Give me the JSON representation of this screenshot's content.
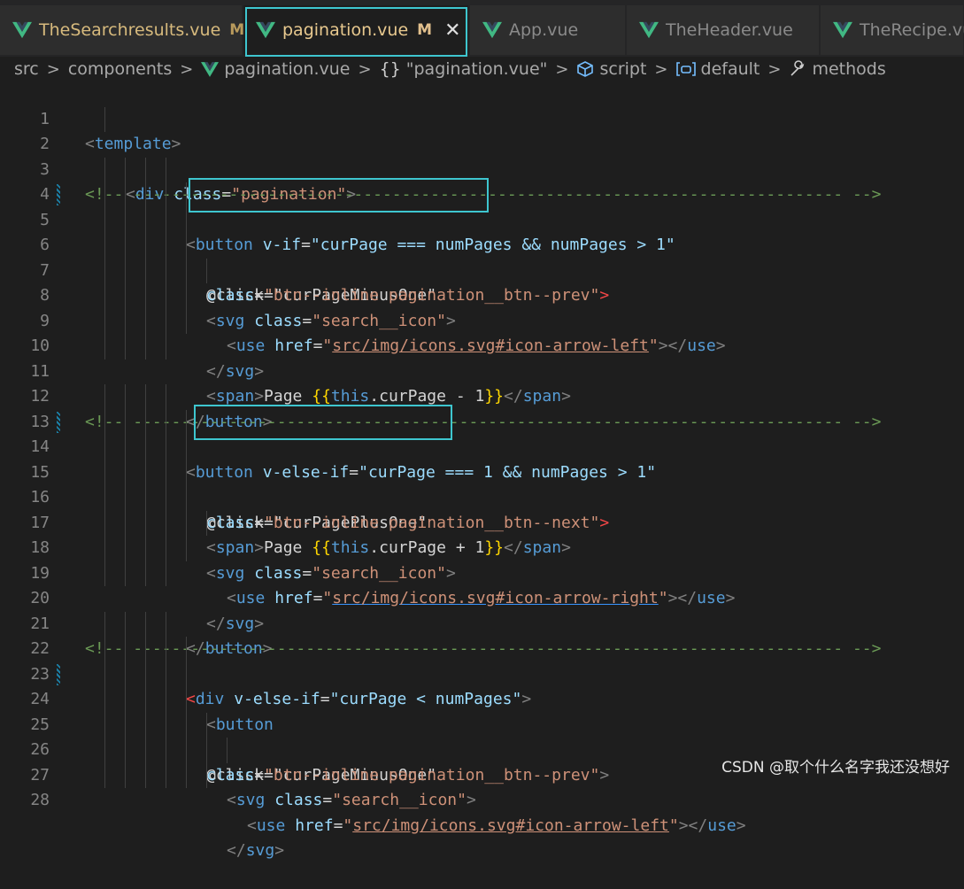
{
  "tabs": [
    {
      "label": "TheSearchresults.vue",
      "modified": "M",
      "active": false
    },
    {
      "label": "pagination.vue",
      "modified": "M",
      "active": true,
      "close": "✕"
    },
    {
      "label": "App.vue",
      "modified": "",
      "active": false
    },
    {
      "label": "TheHeader.vue",
      "modified": "",
      "active": false
    },
    {
      "label": "TheRecipe.vue",
      "modified": "",
      "active": false
    }
  ],
  "breadcrumb": {
    "items": [
      "src",
      "components",
      "pagination.vue",
      "\"pagination.vue\"",
      "script",
      "default",
      "methods"
    ],
    "braces_glyph": "{}",
    "separator": ">"
  },
  "colors": {
    "vue_green": "#41b883",
    "highlight": "#3ec6cf",
    "modified": "#e2c08d"
  },
  "editor": {
    "lines": [
      {
        "n": "1"
      },
      {
        "n": "2"
      },
      {
        "n": "3"
      },
      {
        "n": "4"
      },
      {
        "n": "5"
      },
      {
        "n": "6"
      },
      {
        "n": "7"
      },
      {
        "n": "8"
      },
      {
        "n": "9"
      },
      {
        "n": "10"
      },
      {
        "n": "11"
      },
      {
        "n": "12"
      },
      {
        "n": "13"
      },
      {
        "n": "14"
      },
      {
        "n": "15"
      },
      {
        "n": "16"
      },
      {
        "n": "17"
      },
      {
        "n": "18"
      },
      {
        "n": "19"
      },
      {
        "n": "20"
      },
      {
        "n": "21"
      },
      {
        "n": "22"
      },
      {
        "n": "23"
      },
      {
        "n": "24"
      },
      {
        "n": "25"
      },
      {
        "n": "26"
      },
      {
        "n": "27"
      },
      {
        "n": "28"
      }
    ],
    "tokens": {
      "l1_template": "template",
      "l2_div": "div",
      "l2_class": "class",
      "l2_val": "\"pagination\"",
      "comment_open": "<!-- ",
      "comment_dashes": "--------------------------------------------------------------------------",
      "comment_close": " -->",
      "l4_button": "button",
      "l4_vif": "v-if",
      "l4_val": "\"curPage === numPages && numPages > 1\"",
      "l5_click": "@click=\"curPageMinusOne\"",
      "l6_class": "class",
      "l6_val": "\"btn--inline pagination__btn--prev\"",
      "svg": "svg",
      "svg_class": "class",
      "svg_class_val": "\"search__icon\"",
      "use": "use",
      "href": "href",
      "href_left": "src/img/icons.svg#icon-arrow-left",
      "href_right": "src/img/icons.svg#icon-arrow-right",
      "quote": "\"",
      "span": "span",
      "page_text": "Page ",
      "mustache_open": "{{",
      "mustache_close": "}}",
      "this_kw": "this",
      "minus_expr": ".curPage - 1",
      "plus_expr": ".curPage + 1",
      "l13_button": "button",
      "l13_velseif": "v-else-if",
      "l13_val": "\"curPage === 1 && numPages > 1\"",
      "l14_click": "@click=\"curPagePlusOne\"",
      "l15_val": "\"btn--inline pagination__btn--next\"",
      "l22_div": "div",
      "l22_velseif": "v-else-if",
      "l22_val": "\"curPage < numPages\"",
      "l23_button": "button",
      "l24_click": "@click=\"curPageMinusOne\""
    }
  },
  "watermark": "CSDN @取个什么名字我还没想好"
}
